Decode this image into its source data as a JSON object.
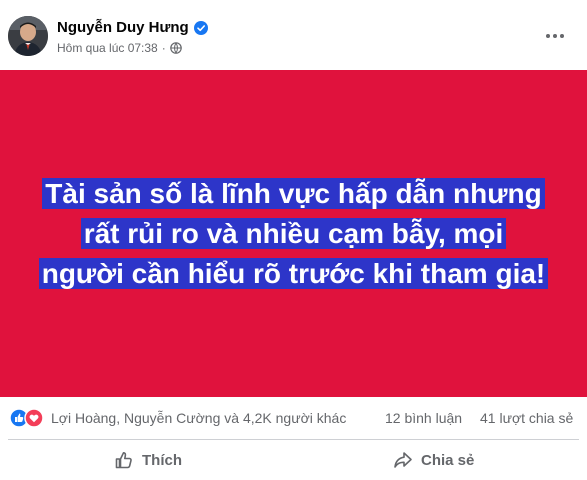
{
  "post": {
    "author": "Nguyễn Duy Hưng",
    "timestamp": "Hôm qua lúc 07:38",
    "separator": "·",
    "privacy_icon": "globe-icon",
    "verified_icon": "verified-badge-icon",
    "more_icon": "more-options-icon"
  },
  "image": {
    "background_color": "#e0123d",
    "highlight_color": "#2d35c9",
    "lines": [
      "Tài sản số là lĩnh vực hấp dẫn nhưng",
      "rất rủi ro và nhiều cạm bẫy, mọi",
      "người cần hiểu rõ trước khi tham gia!"
    ]
  },
  "reactions": {
    "icons": [
      "like-icon",
      "love-icon"
    ],
    "names": "Lợi Hoàng, Nguyễn Cường và 4,2K người khác",
    "comments": "12 bình luận",
    "shares": "41 lượt chia sẻ"
  },
  "actions": {
    "like_label": "Thích",
    "share_label": "Chia sẻ"
  }
}
